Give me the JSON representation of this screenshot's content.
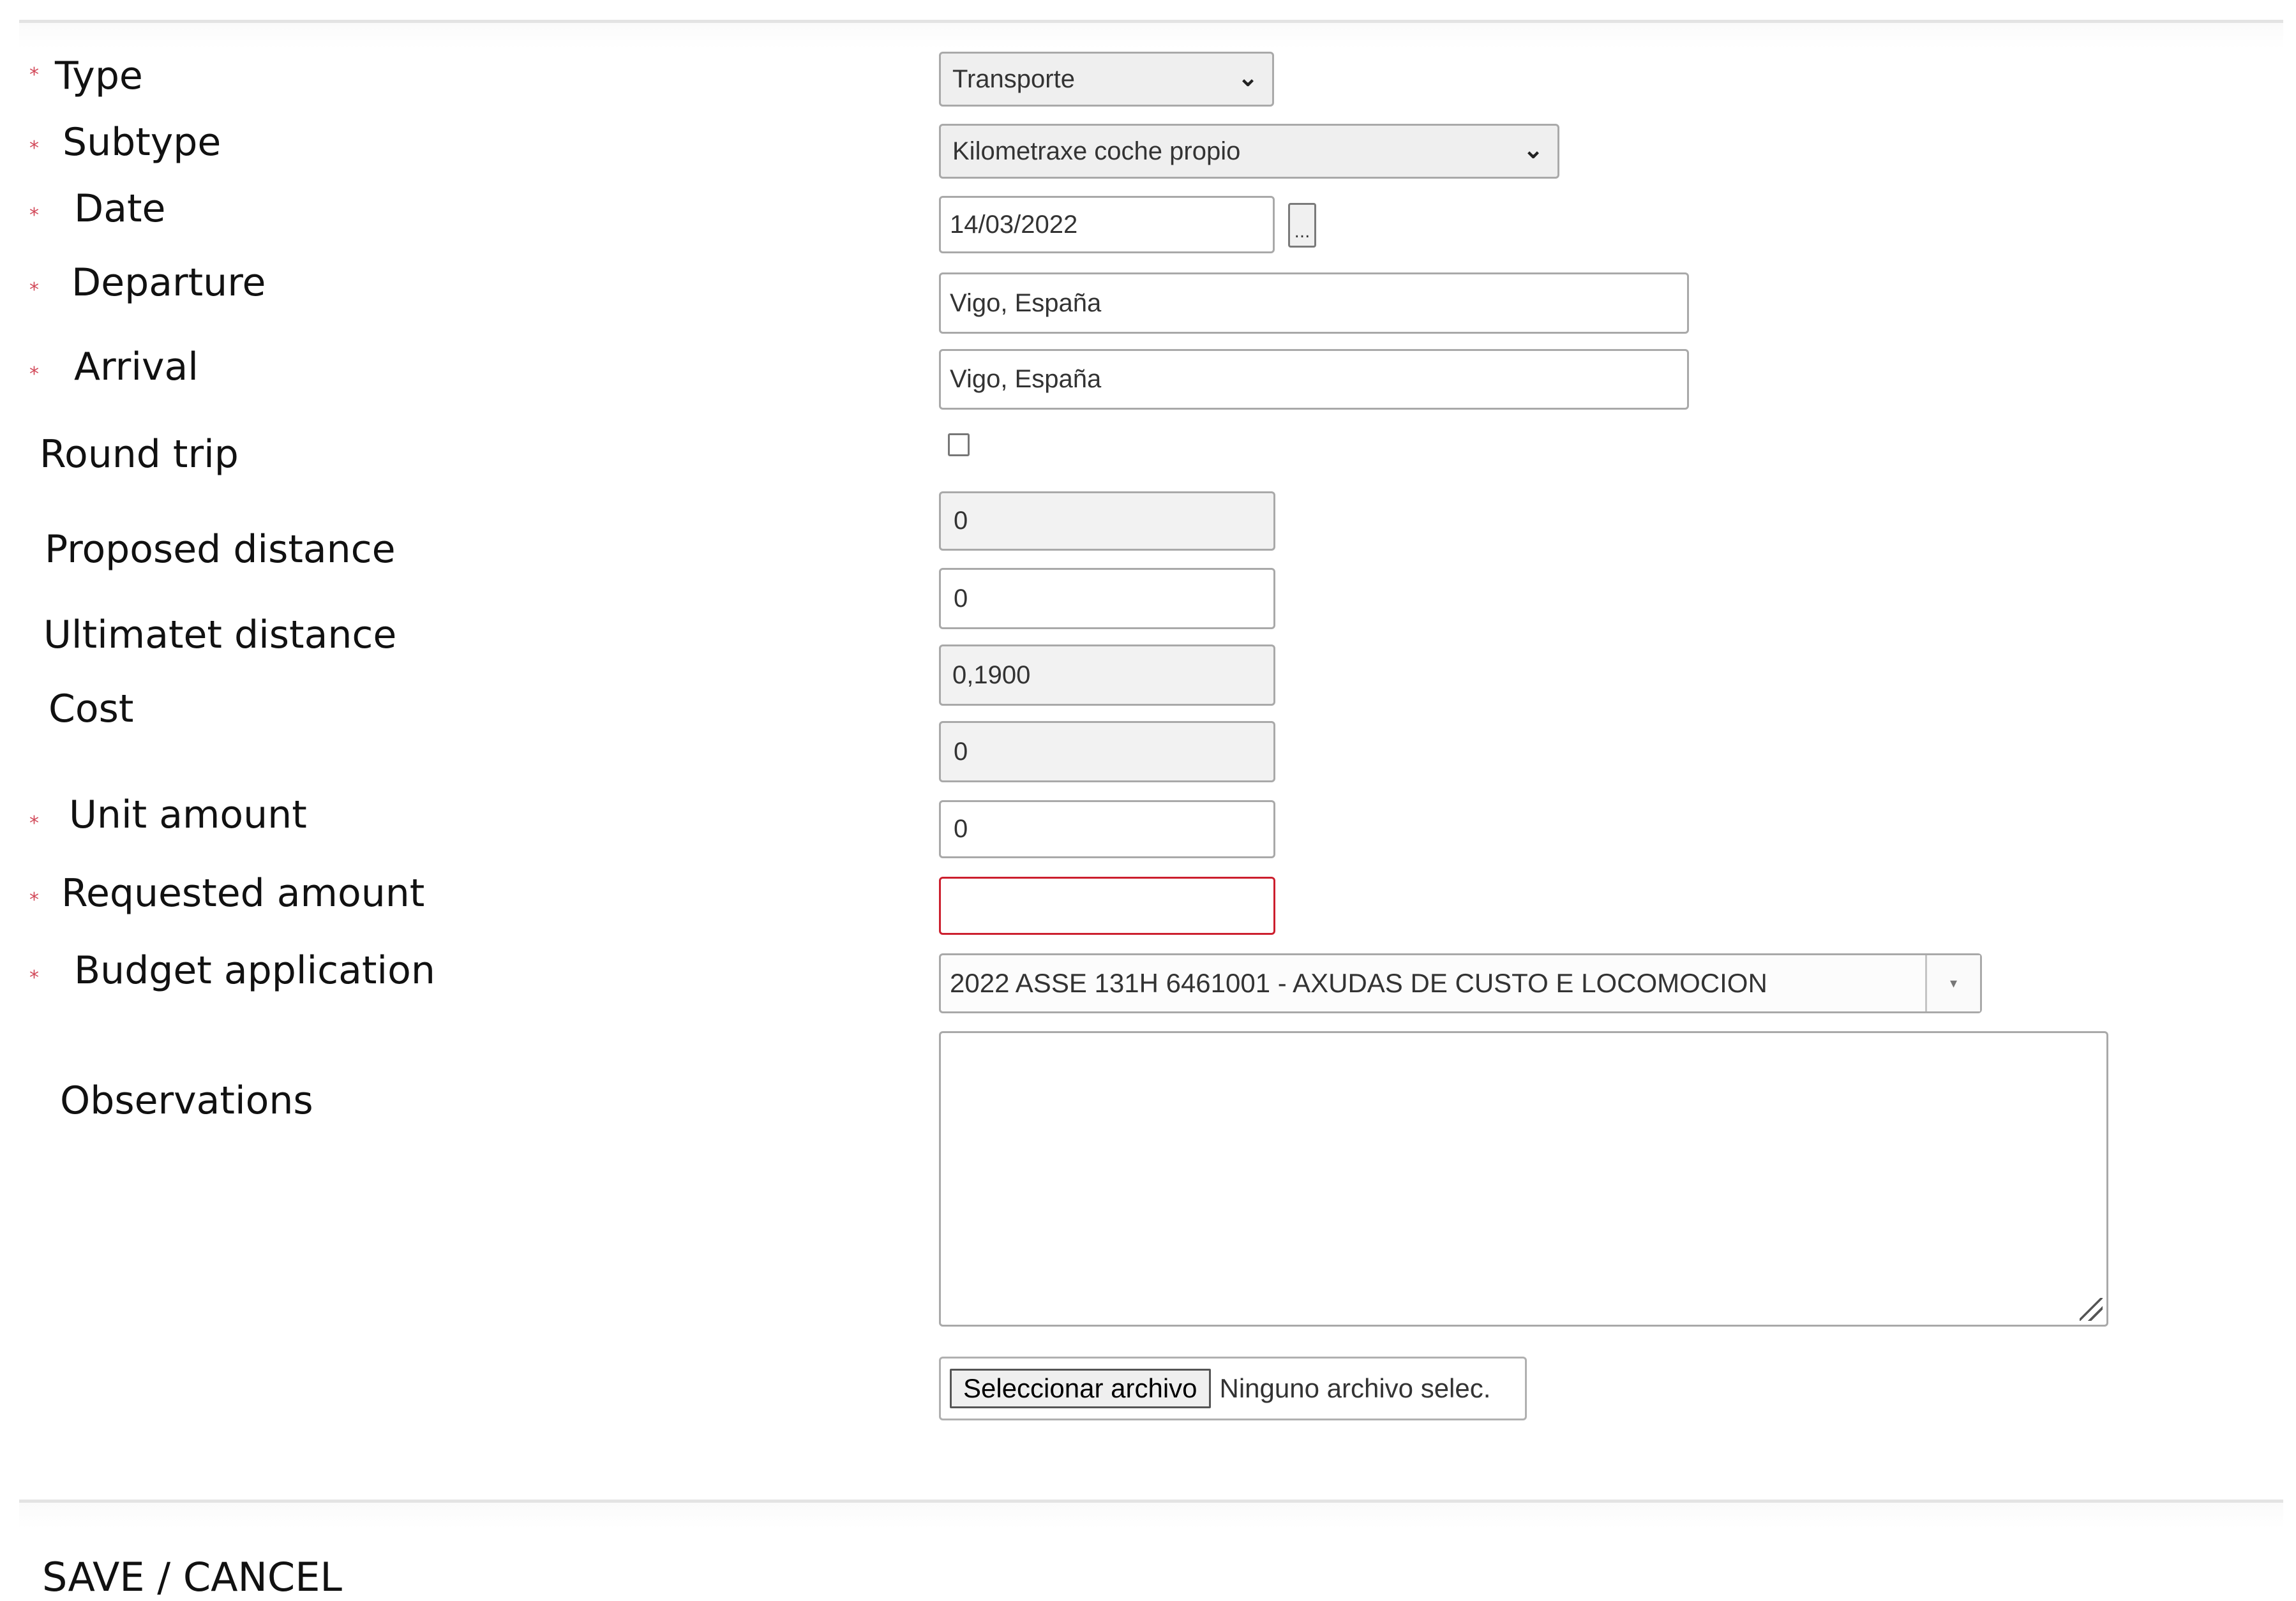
{
  "form": {
    "fields": [
      {
        "label": "Type",
        "required": true,
        "kind": "select",
        "value": "Transporte"
      },
      {
        "label": "Subtype",
        "required": true,
        "kind": "select",
        "value": "Kilometraxe coche propio"
      },
      {
        "label": "Date",
        "required": true,
        "kind": "date",
        "value": "14/03/2022",
        "picker_label": "..."
      },
      {
        "label": "Departure",
        "required": true,
        "kind": "text",
        "value": "Vigo, España"
      },
      {
        "label": "Arrival",
        "required": true,
        "kind": "text",
        "value": "Vigo, España"
      },
      {
        "label": "Round trip",
        "required": false,
        "kind": "checkbox",
        "checked": false
      },
      {
        "label": "Proposed distance",
        "required": false,
        "kind": "readonly",
        "value": "0"
      },
      {
        "label": "Ultimatet distance",
        "required": false,
        "kind": "text",
        "value": "0"
      },
      {
        "label": "Cost",
        "required": false,
        "kind": "readonly",
        "value": "0,1900"
      },
      {
        "label": "",
        "required": false,
        "kind": "readonly",
        "value": "0"
      },
      {
        "label": "Unit amount",
        "required": true,
        "kind": "text",
        "value": "0"
      },
      {
        "label": "Requested amount",
        "required": true,
        "kind": "text",
        "value": "",
        "error": true
      },
      {
        "label": "Budget application",
        "required": true,
        "kind": "combobox",
        "value": "2022 ASSE 131H 6461001 - AXUDAS DE CUSTO E LOCOMOCION",
        "arrow_icon": "dropdown-arrow-icon"
      },
      {
        "label": "Observations",
        "required": false,
        "kind": "textarea",
        "value": ""
      }
    ],
    "file_input": {
      "button_label": "Seleccionar archivo",
      "status": "Ninguno archivo selec."
    },
    "required_marker": "*",
    "colors": {
      "required_marker": "#d24a5a",
      "error_border": "#cc1f2e",
      "readonly_bg": "#f2f2f2"
    }
  },
  "footer": {
    "actions_label": "SAVE / CANCEL"
  }
}
